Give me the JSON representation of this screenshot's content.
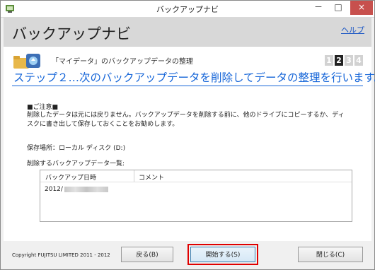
{
  "window": {
    "title": "バックアップナビ",
    "minimize": "－",
    "maximize": "□",
    "close": "×"
  },
  "header": {
    "title": "バックアップナビ",
    "help": "ヘルプ"
  },
  "step": {
    "subtitle": "「マイデータ」のバックアップデータの整理",
    "numbers": [
      "1",
      "2",
      "3",
      "4"
    ],
    "current": "2",
    "heading": "ステップ２…次のバックアップデータを削除してデータの整理を行います。"
  },
  "notice": {
    "title": "■ご注意■",
    "body": "削除したデータは元には戻りません。バックアップデータを削除する前に、他のドライブにコピーするか、ディスクに書き出して保存しておくことをお勧めします。"
  },
  "location": {
    "text": "保存場所：ローカル ディスク (D:)"
  },
  "list": {
    "caption": "削除するバックアップデータ一覧:",
    "columns": [
      "バックアップ日時",
      "コメント"
    ],
    "rows": [
      {
        "date": "2012/",
        "comment": ""
      }
    ]
  },
  "footer": {
    "copyright": "Copyright FUJITSU LIMITED 2011 - 2012",
    "back": "戻る(B)",
    "start": "開始する(S)",
    "close": "閉じる(C)"
  },
  "colors": {
    "accent": "#1565d8",
    "highlight": "#e00000",
    "close_button": "#c7504d"
  }
}
